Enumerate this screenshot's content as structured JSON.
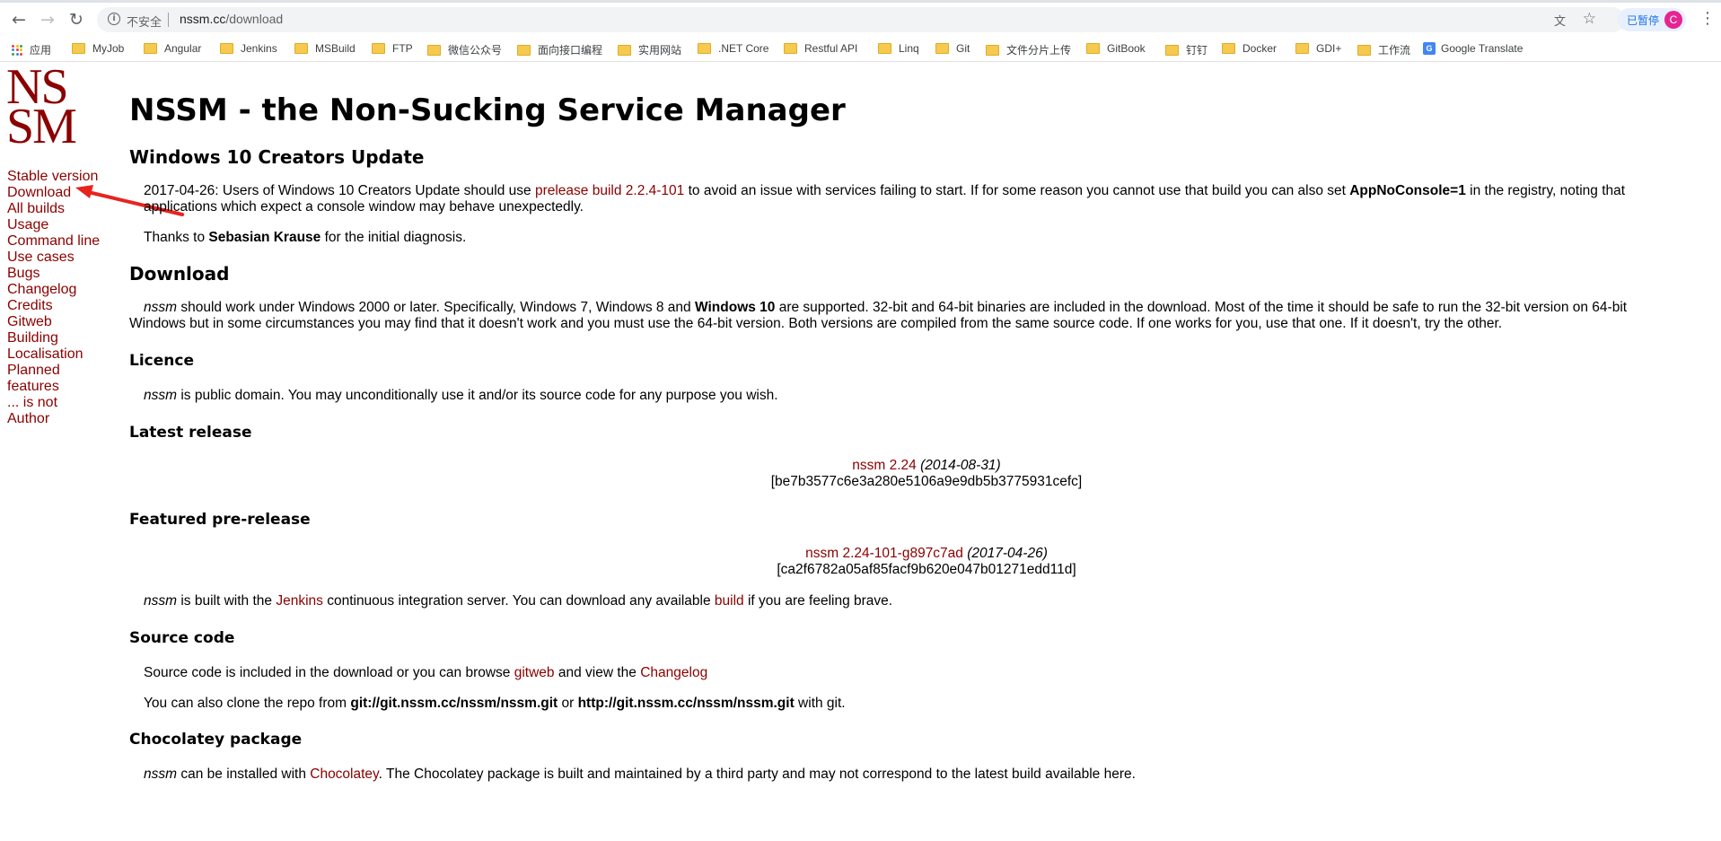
{
  "browser": {
    "security_label": "不安全",
    "url_host": "nssm.cc",
    "url_path": "/download",
    "profile_label": "已暂停",
    "profile_initial": "C",
    "icons": [
      "back-icon",
      "forward-icon",
      "reload-icon",
      "info-icon",
      "translate-icon",
      "star-icon",
      "menu-icon"
    ]
  },
  "bookmarks": {
    "apps_label": "应用",
    "items": [
      "MyJob",
      "Angular",
      "Jenkins",
      "MSBuild",
      "FTP",
      "微信公众号",
      "面向接口编程",
      "实用网站",
      ".NET Core",
      "Restful API",
      "Linq",
      "Git",
      "文件分片上传",
      "GitBook",
      "钉钉",
      "Docker",
      "GDI+",
      "工作流"
    ],
    "google_translate": "Google Translate",
    "folder_color": "#f6c94f"
  },
  "logo": {
    "line1": "NS",
    "line2": "SM",
    "color": "#8b0000"
  },
  "sidebar": {
    "links": [
      "Stable version",
      "Download",
      "All builds",
      "Usage",
      "Command line",
      "Use cases",
      "Bugs",
      "Changelog",
      "Credits",
      "Gitweb",
      "Building",
      "Localisation",
      "Planned",
      "features",
      "... is not",
      "Author"
    ],
    "link_color": "#8b0000",
    "annotation_arrow_color": "#e8231e"
  },
  "page": {
    "title": "NSSM - the Non-Sucking Service Manager",
    "creators": {
      "heading": "Windows 10 Creators Update",
      "p1_a": "2017-04-26: Users of Windows 10 Creators Update should use ",
      "p1_link": "prelease build 2.2.4-101",
      "p1_b": " to avoid an issue with services failing to start. If for some reason you cannot use that build you can also set ",
      "p1_bold": "AppNoConsole=1",
      "p1_c": " in the registry, noting that applications which expect a console window may behave unexpectedly.",
      "p2_a": "Thanks to ",
      "p2_bold": "Sebasian Krause",
      "p2_b": " for the initial diagnosis."
    },
    "download": {
      "heading": "Download",
      "nssm": "nssm",
      "p_a": " should work under Windows 2000 or later. Specifically, Windows 7, Windows 8 and ",
      "p_bold": "Windows 10",
      "p_b": " are supported. 32-bit and 64-bit binaries are included in the download. Most of the time it should be safe to run the 32-bit version on 64-bit Windows but in some circumstances you may find that it doesn't work and you must use the 64-bit version. Both versions are compiled from the same source code. If one works for you, use that one. If it doesn't, try the other."
    },
    "licence": {
      "heading": "Licence",
      "nssm": "nssm",
      "p": " is public domain. You may unconditionally use it and/or its source code for any purpose you wish."
    },
    "latest": {
      "heading": "Latest release",
      "link": "nssm 2.24",
      "date": "(2014-08-31)",
      "hash": "[be7b3577c6e3a280e5106a9e9db5b3775931cefc]"
    },
    "prerelease": {
      "heading": "Featured pre-release",
      "link": "nssm 2.24-101-g897c7ad",
      "date": "(2017-04-26)",
      "hash": "[ca2f6782a05af85facf9b620e047b01271edd11d]",
      "nssm": "nssm",
      "p_a": " is built with the ",
      "p_link1": "Jenkins",
      "p_b": " continuous integration server. You can download any available ",
      "p_link2": "build",
      "p_c": " if you are feeling brave."
    },
    "source": {
      "heading": "Source code",
      "p1_a": "Source code is included in the download or you can browse ",
      "p1_link1": "gitweb",
      "p1_b": " and view the ",
      "p1_link2": "Changelog",
      "p2_a": "You can also clone the repo from ",
      "p2_bold1": "git://git.nssm.cc/nssm/nssm.git",
      "p2_b": " or ",
      "p2_bold2": "http://git.nssm.cc/nssm/nssm.git",
      "p2_c": " with git."
    },
    "chocolatey": {
      "heading": "Chocolatey package",
      "nssm": "nssm",
      "p_a": " can be installed with ",
      "p_link": "Chocolatey",
      "p_b": ". The Chocolatey package is built and maintained by a third party and may not correspond to the latest build available here."
    }
  }
}
